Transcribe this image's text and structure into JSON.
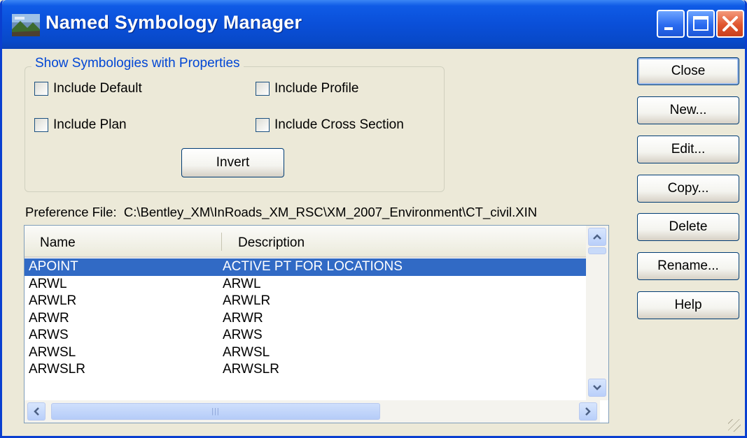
{
  "window": {
    "title": "Named Symbology Manager",
    "controls": {
      "minimize_icon": "minimize-icon",
      "maximize_icon": "maximize-icon",
      "close_icon": "close-icon"
    },
    "accent": "#0a4fd8",
    "title_color": "#ffffff"
  },
  "filter_group": {
    "label": "Show Symbologies with Properties",
    "checkboxes": [
      {
        "label": "Include Default",
        "checked": false
      },
      {
        "label": "Include Profile",
        "checked": false
      },
      {
        "label": "Include Plan",
        "checked": false
      },
      {
        "label": "Include Cross Section",
        "checked": false
      }
    ],
    "invert_label": "Invert"
  },
  "preference": {
    "label": "Preference File:",
    "path": "C:\\Bentley_XM\\InRoads_XM_RSC\\XM_2007_Environment\\CT_civil.XIN"
  },
  "list": {
    "columns": [
      "Name",
      "Description"
    ],
    "rows": [
      {
        "name": "APOINT",
        "description": "ACTIVE PT FOR LOCATIONS",
        "selected": true
      },
      {
        "name": "ARWL",
        "description": "ARWL",
        "selected": false
      },
      {
        "name": "ARWLR",
        "description": "ARWLR",
        "selected": false
      },
      {
        "name": "ARWR",
        "description": "ARWR",
        "selected": false
      },
      {
        "name": "ARWS",
        "description": "ARWS",
        "selected": false
      },
      {
        "name": "ARWSL",
        "description": "ARWSL",
        "selected": false
      },
      {
        "name": "ARWSLR",
        "description": "ARWSLR",
        "selected": false
      }
    ],
    "selection_color": "#316ac5"
  },
  "buttons": {
    "close": "Close",
    "new": "New...",
    "edit": "Edit...",
    "copy": "Copy...",
    "delete": "Delete",
    "rename": "Rename...",
    "help": "Help"
  }
}
